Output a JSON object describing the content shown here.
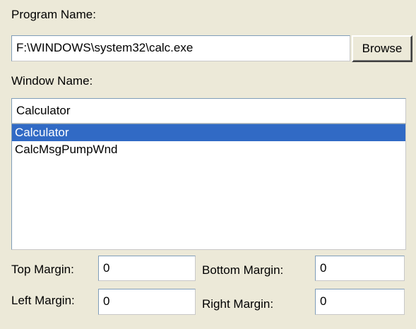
{
  "program": {
    "label": "Program Name:",
    "value": "F:\\WINDOWS\\system32\\calc.exe",
    "browse_label": "Browse"
  },
  "window": {
    "label": "Window Name:",
    "value": "Calculator",
    "items": [
      "Calculator",
      "CalcMsgPumpWnd"
    ],
    "selected_index": 0,
    "selection_color": "#316ac5"
  },
  "margins": {
    "top_label": "Top Margin:",
    "top_value": "0",
    "bottom_label": "Bottom Margin:",
    "bottom_value": "0",
    "left_label": "Left Margin:",
    "left_value": "0",
    "right_label": "Right Margin:",
    "right_value": "0"
  }
}
